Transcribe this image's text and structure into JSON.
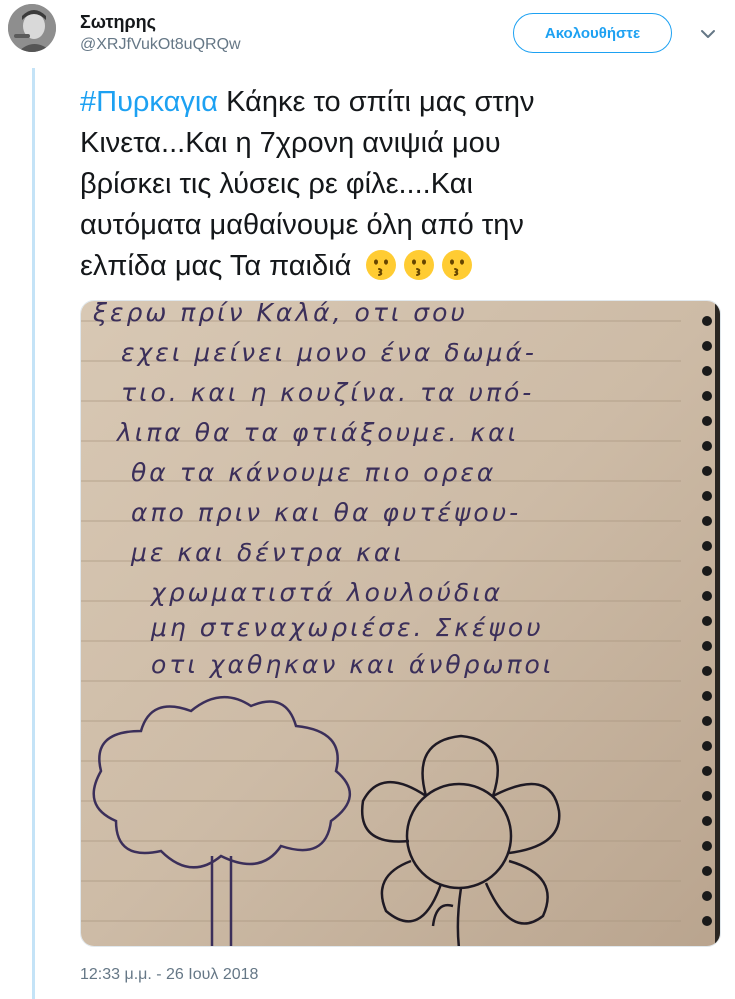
{
  "tweet": {
    "display_name": "Σωτηρης",
    "handle": "@XRJfVukOt8uQRQw",
    "follow_label": "Ακολουθήστε",
    "hashtag": "#Πυρκαγια",
    "text_line1": " Κάηκε το σπίτι μας στην",
    "text_line2": "Κινετα...Και η 7χρονη ανιψιά μου",
    "text_line3": "βρίσκει τις λύσεις ρε φίλε....Και",
    "text_line4": "αυτόματα μαθαίνουμε όλη από την",
    "text_line5": "ελπίδα μας Τα παιδιά",
    "emojis": [
      "kissing-face-emoji",
      "kissing-face-emoji",
      "kissing-face-emoji"
    ],
    "timestamp": "12:33 μ.μ. - 26 Ιουλ 2018"
  },
  "note": {
    "lines": [
      "ξερω πρίν Καλά, οτι σου",
      "εχει μείνει μονο ένα δωμά-",
      "τιο. και η κουζίνα. τα υπό-",
      "λιπα θα τα φτιάξουμε. και",
      "θα τα κάνουμε πιο ορεα",
      "απο πριν και θα φυτέψου-",
      "με και δέντρα και",
      "χρωματιστά λουλούδια",
      "μη στεναχωριέσε. Σκέψου",
      "οτι χαθηκαν και άνθρωποι"
    ]
  },
  "colors": {
    "accent": "#1da1f2",
    "text": "#14171a",
    "muted": "#657786",
    "thread": "#c4e3f7"
  }
}
